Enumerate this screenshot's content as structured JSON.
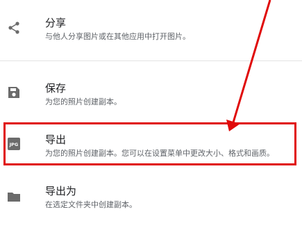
{
  "menu": {
    "items": [
      {
        "title": "分享",
        "description": "与他人分享图片或在其他应用中打开图片。",
        "icon": "share-icon"
      },
      {
        "title": "保存",
        "description": "为您的照片创建副本。",
        "icon": "save-icon"
      },
      {
        "title": "导出",
        "description": "为您的照片创建副本。您可以在设置菜单中更改大小、格式和画质。",
        "icon": "jpg-file-icon",
        "icon_text": "JPG"
      },
      {
        "title": "导出为",
        "description": "在选定文件夹中创建副本。",
        "icon": "folder-icon"
      }
    ]
  },
  "annotation": {
    "color": "#e00a0a",
    "highlighted_item": "导出"
  },
  "colors": {
    "icon": "#6b6b6b",
    "title": "#202124",
    "description": "#5f6368",
    "divider": "#e3e3e3"
  }
}
